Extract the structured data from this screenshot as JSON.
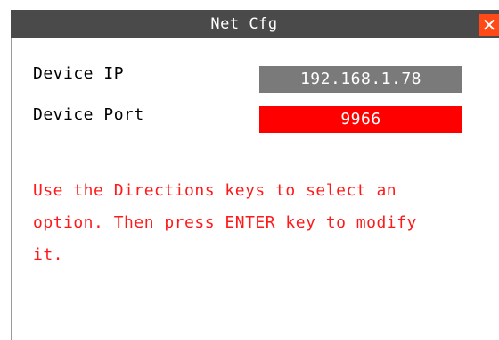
{
  "dialog": {
    "title": "Net Cfg",
    "close_icon": "close-icon",
    "colors": {
      "titlebar": "#4a4a4a",
      "close": "#ff4a17",
      "field_normal": "#7a7a7a",
      "field_selected": "#ff0000",
      "hint": "#ff1a1a"
    }
  },
  "fields": {
    "ip_label": "Device IP",
    "ip_value": "192.168.1.78",
    "port_label": "Device Port",
    "port_value": "9966"
  },
  "hint": {
    "line1": "Use the Directions keys to select an",
    "line2": "option. Then press ENTER key to modify",
    "line3": "it."
  }
}
